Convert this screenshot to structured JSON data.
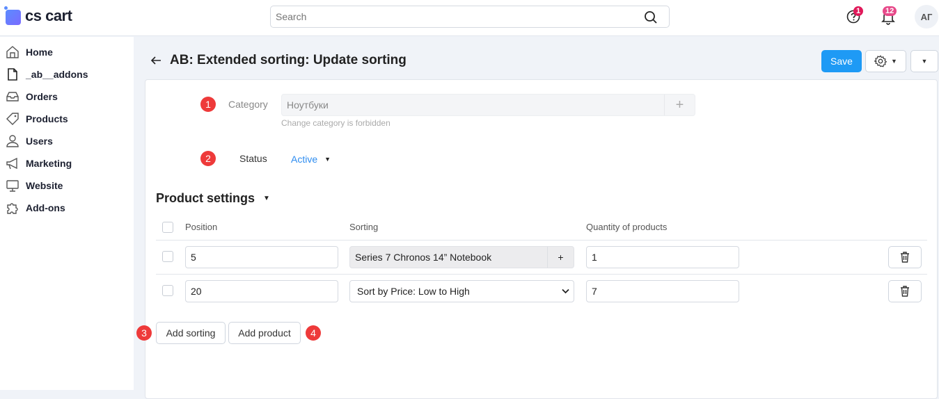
{
  "header": {
    "logo": "cs cart",
    "search_placeholder": "Search",
    "help_count": "1",
    "notifications_count": "12",
    "avatar": "АГ"
  },
  "sidebar": {
    "items": [
      {
        "label": "Home",
        "icon": "home-icon"
      },
      {
        "label": "_ab__addons",
        "icon": "file-icon"
      },
      {
        "label": "Orders",
        "icon": "inbox-icon"
      },
      {
        "label": "Products",
        "icon": "tag-icon"
      },
      {
        "label": "Users",
        "icon": "user-icon"
      },
      {
        "label": "Marketing",
        "icon": "megaphone-icon"
      },
      {
        "label": "Website",
        "icon": "monitor-icon"
      },
      {
        "label": "Add-ons",
        "icon": "puzzle-icon"
      }
    ]
  },
  "page": {
    "title": "AB: Extended sorting: Update sorting",
    "save": "Save"
  },
  "form": {
    "category_label": "Category",
    "category_value": "Ноутбуки",
    "category_hint": "Change category is forbidden",
    "status_label": "Status",
    "status_value": "Active"
  },
  "markers": [
    "1",
    "2",
    "3",
    "4"
  ],
  "product_settings": {
    "title": "Product settings",
    "columns": [
      "Position",
      "Sorting",
      "Quantity of products"
    ],
    "rows": [
      {
        "position": "5",
        "sorting": "Series 7 Chronos 14” Notebook",
        "quantity": "1"
      },
      {
        "position": "20",
        "sorting": "Sort by Price: Low to High",
        "quantity": "7"
      }
    ],
    "add_sorting": "Add sorting",
    "add_product": "Add product"
  },
  "colors": {
    "accent": "#1e9af5",
    "marker": "#ee3a3a",
    "badge": "#e0195a",
    "status": "#2d8cf0"
  }
}
